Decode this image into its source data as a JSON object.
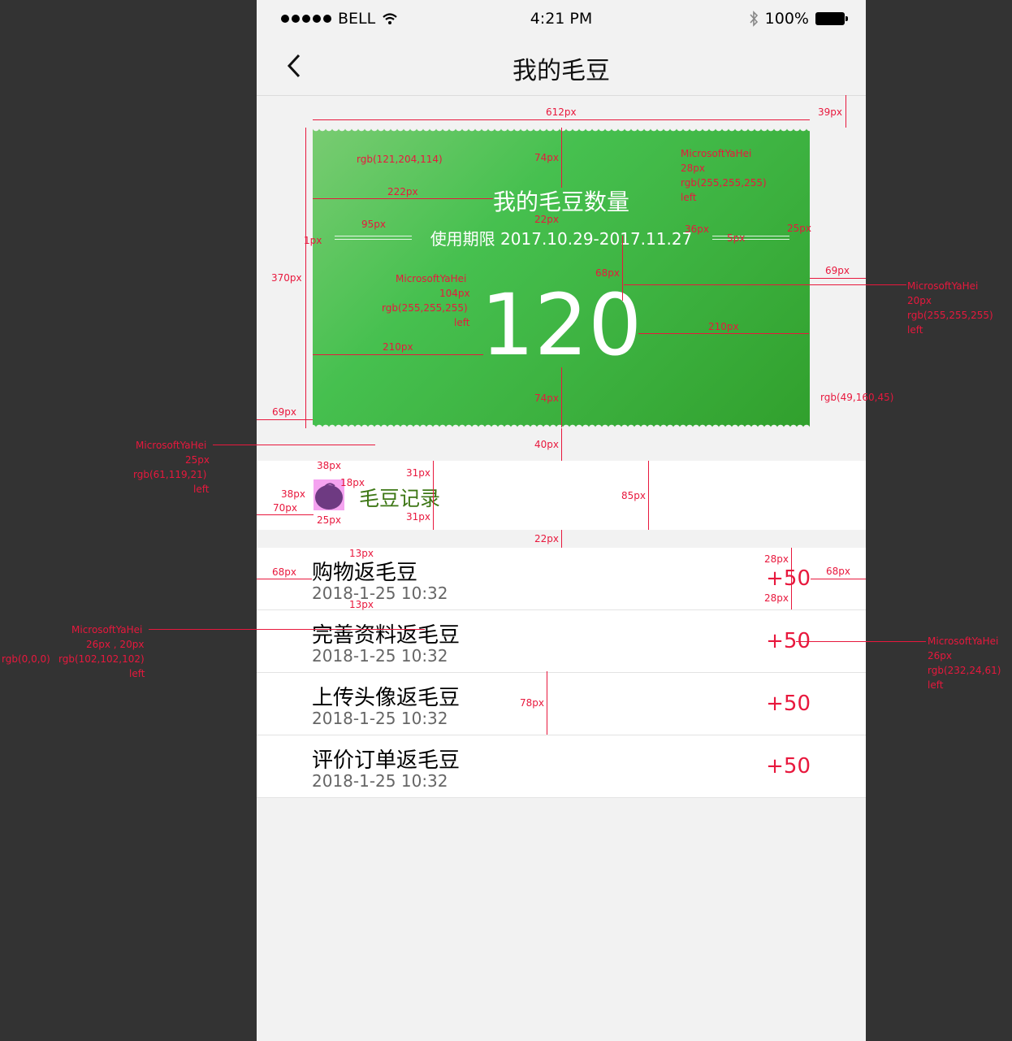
{
  "status": {
    "carrier": "BELL",
    "time": "4:21 PM",
    "battery": "100%"
  },
  "nav": {
    "title": "我的毛豆"
  },
  "card": {
    "title": "我的毛豆数量",
    "period": "使用期限 2017.10.29-2017.11.27",
    "count": "120"
  },
  "record": {
    "label": "毛豆记录"
  },
  "items": [
    {
      "title": "购物返毛豆",
      "time": "2018-1-25  10:32",
      "amount": "+50"
    },
    {
      "title": "完善资料返毛豆",
      "time": "2018-1-25  10:32",
      "amount": "+50"
    },
    {
      "title": "上传头像返毛豆",
      "time": "2018-1-25  10:32",
      "amount": "+50"
    },
    {
      "title": "评价订单返毛豆",
      "time": "2018-1-25  10:32",
      "amount": "+50"
    }
  ],
  "annotations": {
    "a612": "612px",
    "a39": "39px",
    "a74a": "74px",
    "a222": "222px",
    "a22": "22px",
    "a95": "95px",
    "a1": "1px",
    "a36": "36px",
    "a5": "5px",
    "a25a": "25px",
    "a370": "370px",
    "a68a": "68px",
    "a69a": "69px",
    "a210a": "210px",
    "a210b": "210px",
    "a74b": "74px",
    "a69b": "69px",
    "a40": "40px",
    "a38a": "38px",
    "a38b": "38px",
    "a18": "18px",
    "a31a": "31px",
    "a31b": "31px",
    "a70": "70px",
    "a25b": "25px",
    "a85": "85px",
    "a22b": "22px",
    "a13a": "13px",
    "a13b": "13px",
    "a28a": "28px",
    "a28b": "28px",
    "a68b": "68px",
    "a68c": "68px",
    "a78": "78px",
    "c1": "rgb(121,204,114)",
    "f1_font": "MicrosoftYaHei",
    "f1_size": "28px",
    "f1_color": "rgb(255,255,255)",
    "f1_align": "left",
    "f2_font": "MicrosoftYaHei",
    "f2_size": "104px",
    "f2_color": "rgb(255,255,255)",
    "f2_align": "left",
    "f3_font": "MicrosoftYaHei",
    "f3_size": "20px",
    "f3_color": "rgb(255,255,255)",
    "f3_align": "left",
    "c2": "rgb(49,160,45)",
    "f4_font": "MicrosoftYaHei",
    "f4_size": "25px",
    "f4_color": "rgb(61,119,21)",
    "f4_align": "left",
    "f5_font": "MicrosoftYaHei",
    "f5_size": "26px , 20px",
    "f5_c1": "rgb(0,0,0)",
    "f5_c2": "rgb(102,102,102)",
    "f5_align": "left",
    "f6_font": "MicrosoftYaHei",
    "f6_size": "26px",
    "f6_color": "rgb(232,24,61)",
    "f6_align": "left"
  },
  "colors": {
    "green_light": "#79cc72",
    "green_dark": "#31a02d",
    "record_green": "#3d7715",
    "accent_red": "#e8183d",
    "text_gray": "#666666"
  }
}
